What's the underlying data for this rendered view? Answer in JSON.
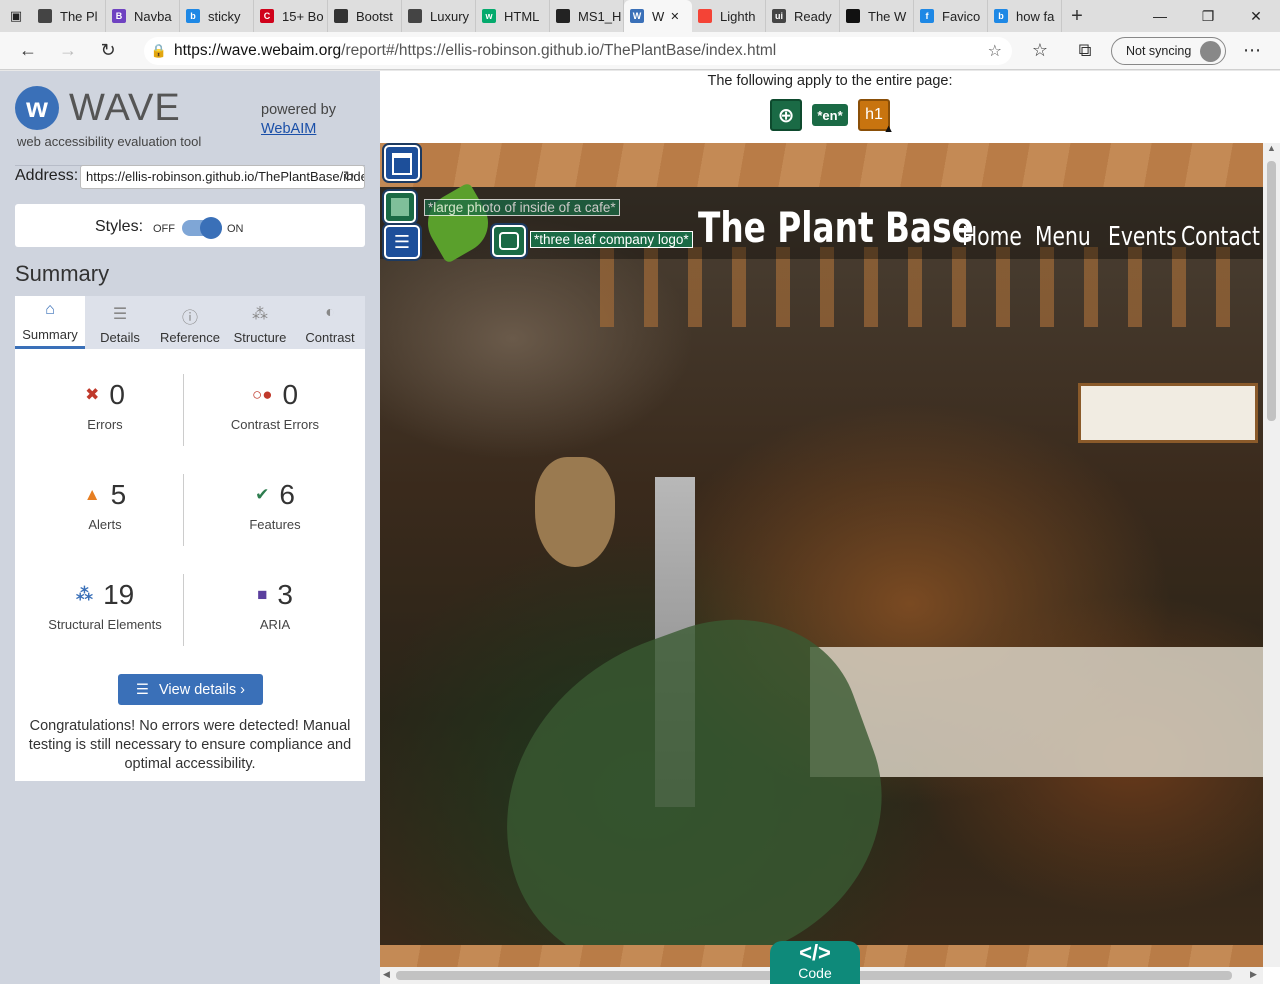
{
  "browser": {
    "tabs": [
      {
        "title": "The Pl",
        "color": "#444"
      },
      {
        "title": "Navba",
        "color": "#6f42c1",
        "glyph": "B"
      },
      {
        "title": "sticky",
        "color": "#1e88e5",
        "glyph": "b"
      },
      {
        "title": "15+ Bo",
        "color": "#d0021b",
        "glyph": "C"
      },
      {
        "title": "Bootst",
        "color": "#333"
      },
      {
        "title": "Luxury",
        "color": "#444"
      },
      {
        "title": "HTML",
        "color": "#04aa6d",
        "glyph": "w"
      },
      {
        "title": "MS1_H",
        "color": "#222"
      },
      {
        "title": "W",
        "color": "#3a70b8",
        "glyph": "W",
        "active": true
      },
      {
        "title": "Lighth",
        "color": "#f44336"
      },
      {
        "title": "Ready",
        "color": "#444",
        "glyph": "ui"
      },
      {
        "title": "The W",
        "color": "#111"
      },
      {
        "title": "Favico",
        "color": "#1e88e5",
        "glyph": "f"
      },
      {
        "title": "how fa",
        "color": "#1e88e5",
        "glyph": "b"
      }
    ],
    "url_host": "https://wave.webaim.org",
    "url_path": "/report#/https://ellis-robinson.github.io/ThePlantBase/index.html",
    "sync_label": "Not syncing"
  },
  "wave": {
    "logo_text": "WAVE",
    "tagline": "web accessibility evaluation tool",
    "powered_by": "powered by",
    "powered_link": "WebAIM",
    "address_label": "Address:",
    "address_value": "https://ellis-robinson.github.io/ThePlantBase/index.html",
    "styles_label": "Styles:",
    "styles_off": "OFF",
    "styles_on": "ON",
    "summary_heading": "Summary",
    "tabs": [
      {
        "label": "Summary",
        "active": true
      },
      {
        "label": "Details"
      },
      {
        "label": "Reference"
      },
      {
        "label": "Structure"
      },
      {
        "label": "Contrast"
      }
    ],
    "stats": [
      {
        "value": "0",
        "label": "Errors",
        "icon": "error-icon",
        "color": "#c0392b"
      },
      {
        "value": "0",
        "label": "Contrast Errors",
        "icon": "contrast-error-icon",
        "color": "#c0392b"
      },
      {
        "value": "5",
        "label": "Alerts",
        "icon": "alert-icon",
        "color": "#e67e22"
      },
      {
        "value": "6",
        "label": "Features",
        "icon": "feature-icon",
        "color": "#2e7d4f"
      },
      {
        "value": "19",
        "label": "Structural Elements",
        "icon": "structure-icon",
        "color": "#3a70b8"
      },
      {
        "value": "3",
        "label": "ARIA",
        "icon": "aria-icon",
        "color": "#5b3f9e"
      }
    ],
    "view_details": "View details ›",
    "congrats": "Congratulations! No errors were detected! Manual testing is still necessary to ensure compliance and optimal accessibility."
  },
  "report": {
    "apply_text": "The following apply to the entire page:",
    "page_icons": [
      {
        "name": "language-globe-icon",
        "text": ""
      },
      {
        "name": "lang-en-badge",
        "text": "*en*"
      },
      {
        "name": "h1-alert-badge",
        "text": "h1"
      }
    ],
    "site_title": "The Plant Base",
    "site_nav": [
      "Home",
      "Menu",
      "Events",
      "Contact"
    ],
    "alt_large": "*large photo of inside of a cafe*",
    "alt_logo": "*three leaf company logo*",
    "code_symbol": "</>",
    "code_label": "Code"
  }
}
